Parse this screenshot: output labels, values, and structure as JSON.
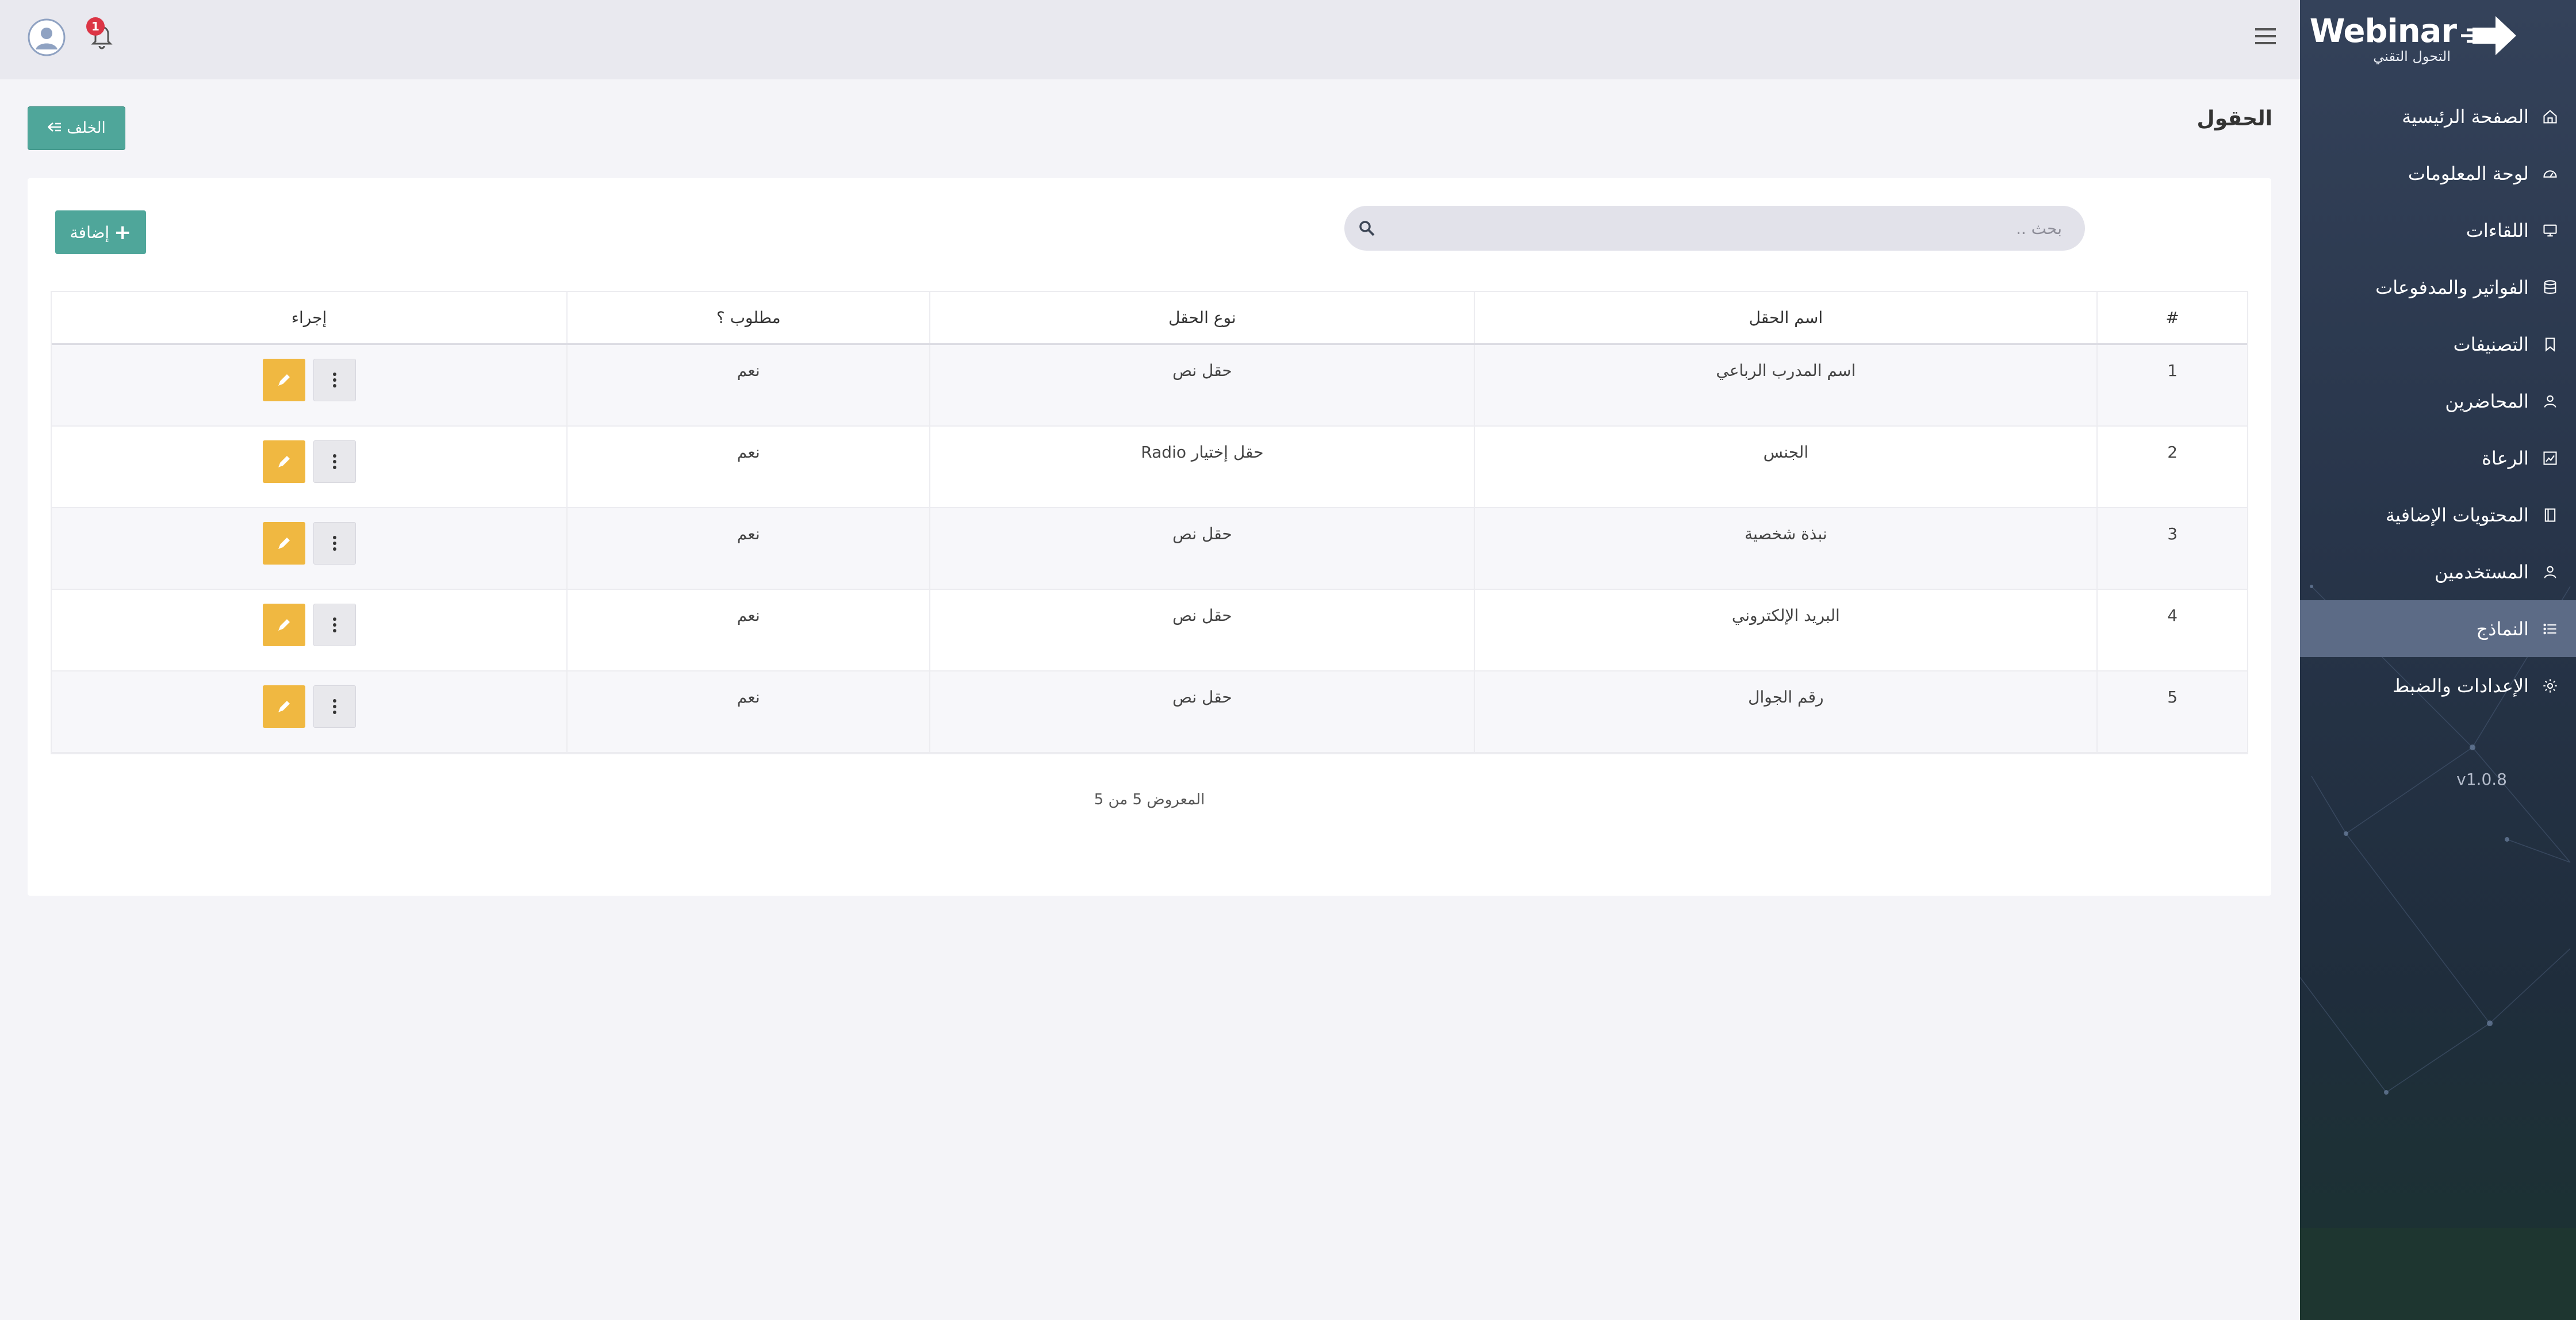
{
  "brand": {
    "name": "Webinar",
    "tagline": "التحول التقني"
  },
  "topbar": {
    "notification_count": "1"
  },
  "sidebar": {
    "items": [
      {
        "label": "الصفحة الرئيسية",
        "icon": "home-icon",
        "active": false
      },
      {
        "label": "لوحة المعلومات",
        "icon": "dashboard-icon",
        "active": false
      },
      {
        "label": "اللقاءات",
        "icon": "monitor-icon",
        "active": false
      },
      {
        "label": "الفواتير والمدفوعات",
        "icon": "database-icon",
        "active": false
      },
      {
        "label": "التصنيفات",
        "icon": "bookmark-icon",
        "active": false
      },
      {
        "label": "المحاضرين",
        "icon": "user-icon",
        "active": false
      },
      {
        "label": "الرعاة",
        "icon": "chart-image-icon",
        "active": false
      },
      {
        "label": "المحتويات الإضافية",
        "icon": "document-icon",
        "active": false
      },
      {
        "label": "المستخدمين",
        "icon": "user-icon",
        "active": false
      },
      {
        "label": "النماذج",
        "icon": "list-icon",
        "active": true
      },
      {
        "label": "الإعدادات والضبط",
        "icon": "gear-icon",
        "active": false
      }
    ],
    "version": "v1.0.8"
  },
  "page": {
    "title": "الحقول",
    "back_label": "الخلف",
    "add_label": "إضافة",
    "search_placeholder": "بحث .."
  },
  "table": {
    "headers": {
      "num": "#",
      "name": "اسم الحقل",
      "type": "نوع الحقل",
      "required": "مطلوب ؟",
      "action": "إجراء"
    },
    "rows": [
      {
        "num": "1",
        "name": "اسم المدرب الرباعي",
        "type": "حقل نص",
        "required": "نعم"
      },
      {
        "num": "2",
        "name": "الجنس",
        "type": "حقل إختيار Radio",
        "required": "نعم"
      },
      {
        "num": "3",
        "name": "نبذة شخصية",
        "type": "حقل نص",
        "required": "نعم"
      },
      {
        "num": "4",
        "name": "البريد الإلكتروني",
        "type": "حقل نص",
        "required": "نعم"
      },
      {
        "num": "5",
        "name": "رقم الجوال",
        "type": "حقل نص",
        "required": "نعم"
      }
    ],
    "footer": "المعروض 5 من 5"
  },
  "colors": {
    "accent": "#4fa69a",
    "edit": "#f0b841",
    "sidebar": "#2b3a50",
    "active_item": "#5c6b86",
    "badge": "#dc3545"
  }
}
